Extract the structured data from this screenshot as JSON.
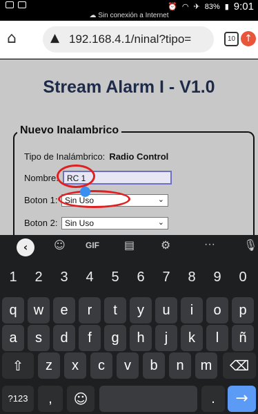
{
  "status_bar": {
    "battery": "83%",
    "time": "9:01",
    "network_note": "Sin conexión a Internet"
  },
  "browser": {
    "url": "192.168.4.1/ninal?tipo=",
    "tab_count": "10"
  },
  "page": {
    "title": "Stream Alarm I - V1.0",
    "legend": "Nuevo Inalambrico",
    "tipo_label": "Tipo de Inalámbrico:",
    "tipo_value": "Radio Control",
    "nombre_label": "Nombre:",
    "nombre_value": "RC 1",
    "boton1_label": "Boton 1:",
    "boton1_value": "Sin Uso",
    "boton2_label": "Boton 2:",
    "boton2_value": "Sin Uso"
  },
  "keyboard": {
    "toolbar": {
      "gif": "GIF",
      "more": "···"
    },
    "row_numbers": [
      "1",
      "2",
      "3",
      "4",
      "5",
      "6",
      "7",
      "8",
      "9",
      "0"
    ],
    "row_q": [
      "q",
      "w",
      "e",
      "r",
      "t",
      "y",
      "u",
      "i",
      "o",
      "p"
    ],
    "row_a": [
      "a",
      "s",
      "d",
      "f",
      "g",
      "h",
      "j",
      "k",
      "l",
      "ñ"
    ],
    "row_z": [
      "z",
      "x",
      "c",
      "v",
      "b",
      "n",
      "m"
    ],
    "symbols_key": "?123",
    "comma_key": ",",
    "period_key": "."
  },
  "icons": [
    "back-icon",
    "sticker-icon",
    "clipboard-icon",
    "settings-icon",
    "mic-icon",
    "shift-icon",
    "backspace-icon",
    "emoji-icon",
    "enter-icon",
    "home-icon",
    "warning-icon",
    "update-icon"
  ]
}
